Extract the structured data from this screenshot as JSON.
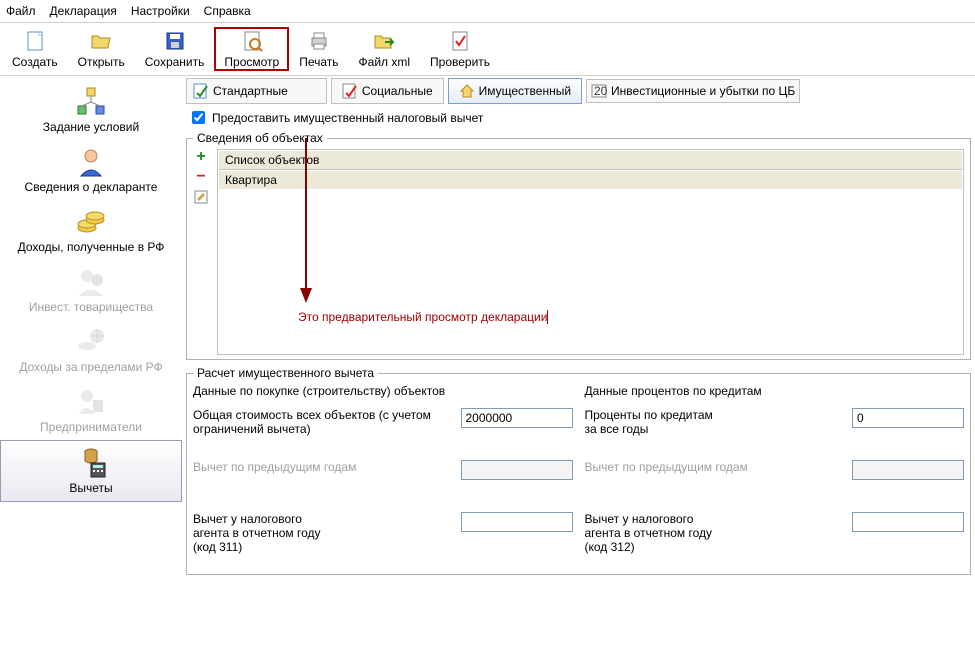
{
  "menu": {
    "file": "Файл",
    "declaration": "Декларация",
    "settings": "Настройки",
    "help": "Справка"
  },
  "toolbar": {
    "create": "Создать",
    "open": "Открыть",
    "save": "Сохранить",
    "preview": "Просмотр",
    "print": "Печать",
    "xml": "Файл xml",
    "check": "Проверить"
  },
  "sidebar": {
    "conditions": "Задание условий",
    "declarant": "Сведения о декларанте",
    "income_rf": "Доходы, полученные в РФ",
    "invest": "Инвест. товарищества",
    "income_abroad": "Доходы за пределами РФ",
    "entrepreneurs": "Предприниматели",
    "deductions": "Вычеты"
  },
  "tabs": {
    "standard": "Стандартные",
    "social": "Социальные",
    "property": "Имущественный",
    "invest": "Инвестиционные и убытки по ЦБ"
  },
  "checkbox": {
    "label": "Предоставить имущественный налоговый вычет",
    "checked": true
  },
  "objects": {
    "legend": "Сведения об объектах",
    "header": "Список объектов",
    "rows": [
      "Квартира"
    ]
  },
  "annotation": "Это предварительный просмотр декларации",
  "calc": {
    "legend": "Расчет имущественного вычета",
    "left": {
      "title": "Данные по покупке (строительству) объектов",
      "total_label": "Общая стоимость всех объектов (с учетом ограничений вычета)",
      "total_value": "2000000",
      "prev_label": "Вычет по предыдущим годам",
      "prev_value": "",
      "agent_label": "Вычет у налогового\nагента в отчетном году\n(код 311)",
      "agent_value": ""
    },
    "right": {
      "title": "Данные процентов по кредитам",
      "total_label": "Проценты по кредитам\nза все годы",
      "total_value": "0",
      "prev_label": "Вычет по предыдущим годам",
      "prev_value": "",
      "agent_label": "Вычет у налогового\nагента в отчетном году\n(код 312)",
      "agent_value": ""
    }
  }
}
